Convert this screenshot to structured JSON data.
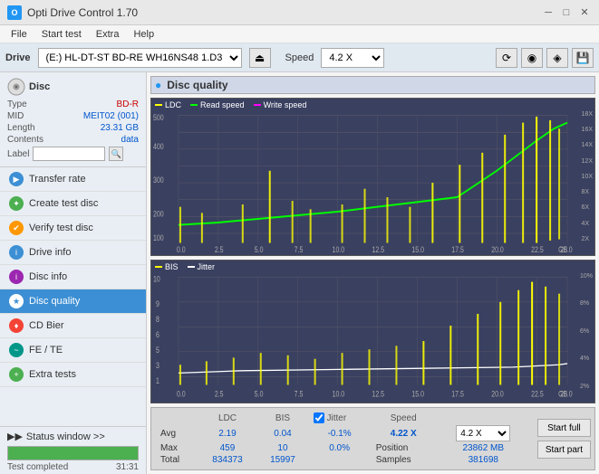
{
  "app": {
    "title": "Opti Drive Control 1.70",
    "icon": "O"
  },
  "titlebar": {
    "minimize": "─",
    "maximize": "□",
    "close": "✕"
  },
  "menu": {
    "items": [
      "File",
      "Start test",
      "Extra",
      "Help"
    ]
  },
  "drivebar": {
    "drive_label": "Drive",
    "drive_value": "(E:)  HL-DT-ST BD-RE  WH16NS48 1.D3",
    "speed_label": "Speed",
    "speed_value": "4.2 X"
  },
  "disc": {
    "section_title": "Disc",
    "type_label": "Type",
    "type_value": "BD-R",
    "mid_label": "MID",
    "mid_value": "MEIT02 (001)",
    "length_label": "Length",
    "length_value": "23.31 GB",
    "contents_label": "Contents",
    "contents_value": "data",
    "label_label": "Label"
  },
  "nav": {
    "items": [
      {
        "id": "transfer-rate",
        "label": "Transfer rate",
        "icon": "▶",
        "color": "blue"
      },
      {
        "id": "create-test-disc",
        "label": "Create test disc",
        "icon": "✦",
        "color": "green"
      },
      {
        "id": "verify-test-disc",
        "label": "Verify test disc",
        "icon": "✔",
        "color": "orange"
      },
      {
        "id": "drive-info",
        "label": "Drive info",
        "icon": "i",
        "color": "blue"
      },
      {
        "id": "disc-info",
        "label": "Disc info",
        "icon": "i",
        "color": "purple"
      },
      {
        "id": "disc-quality",
        "label": "Disc quality",
        "icon": "★",
        "color": "white-active",
        "active": true
      },
      {
        "id": "cd-bier",
        "label": "CD Bier",
        "icon": "♦",
        "color": "red"
      },
      {
        "id": "fe-te",
        "label": "FE / TE",
        "icon": "~",
        "color": "teal"
      },
      {
        "id": "extra-tests",
        "label": "Extra tests",
        "icon": "+",
        "color": "green"
      }
    ]
  },
  "status": {
    "window_label": "Status window >>",
    "progress_pct": 100,
    "status_text": "Test completed",
    "time": "31:31"
  },
  "chart": {
    "title": "Disc quality",
    "icon": "●",
    "legend1": {
      "ldc": "LDC",
      "read": "Read speed",
      "write": "Write speed"
    },
    "legend2": {
      "bis": "BIS",
      "jitter": "Jitter"
    },
    "chart1_ymax": 500,
    "chart1_ylabel": "18X",
    "chart2_ymax": 10,
    "xmax": 25,
    "x_labels": [
      "0.0",
      "2.5",
      "5.0",
      "7.5",
      "10.0",
      "12.5",
      "15.0",
      "17.5",
      "20.0",
      "22.5",
      "25.0"
    ],
    "y1_labels": [
      "18X",
      "16X",
      "14X",
      "12X",
      "10X",
      "8X",
      "6X",
      "4X",
      "2X"
    ],
    "y2_labels": [
      "10%",
      "8%",
      "6%",
      "4%",
      "2%"
    ]
  },
  "stats": {
    "col_headers": [
      "",
      "LDC",
      "BIS",
      "",
      "Jitter",
      "Speed",
      "",
      ""
    ],
    "avg_label": "Avg",
    "avg_ldc": "2.19",
    "avg_bis": "0.04",
    "avg_jitter": "-0.1%",
    "avg_speed": "4.22 X",
    "max_label": "Max",
    "max_ldc": "459",
    "max_bis": "10",
    "max_jitter": "0.0%",
    "max_position_label": "Position",
    "max_position_value": "23862 MB",
    "total_label": "Total",
    "total_ldc": "834373",
    "total_bis": "15997",
    "total_samples_label": "Samples",
    "total_samples_value": "381698",
    "jitter_checked": true,
    "speed_display": "4.2 X",
    "btn_start_full": "Start full",
    "btn_start_part": "Start part"
  }
}
